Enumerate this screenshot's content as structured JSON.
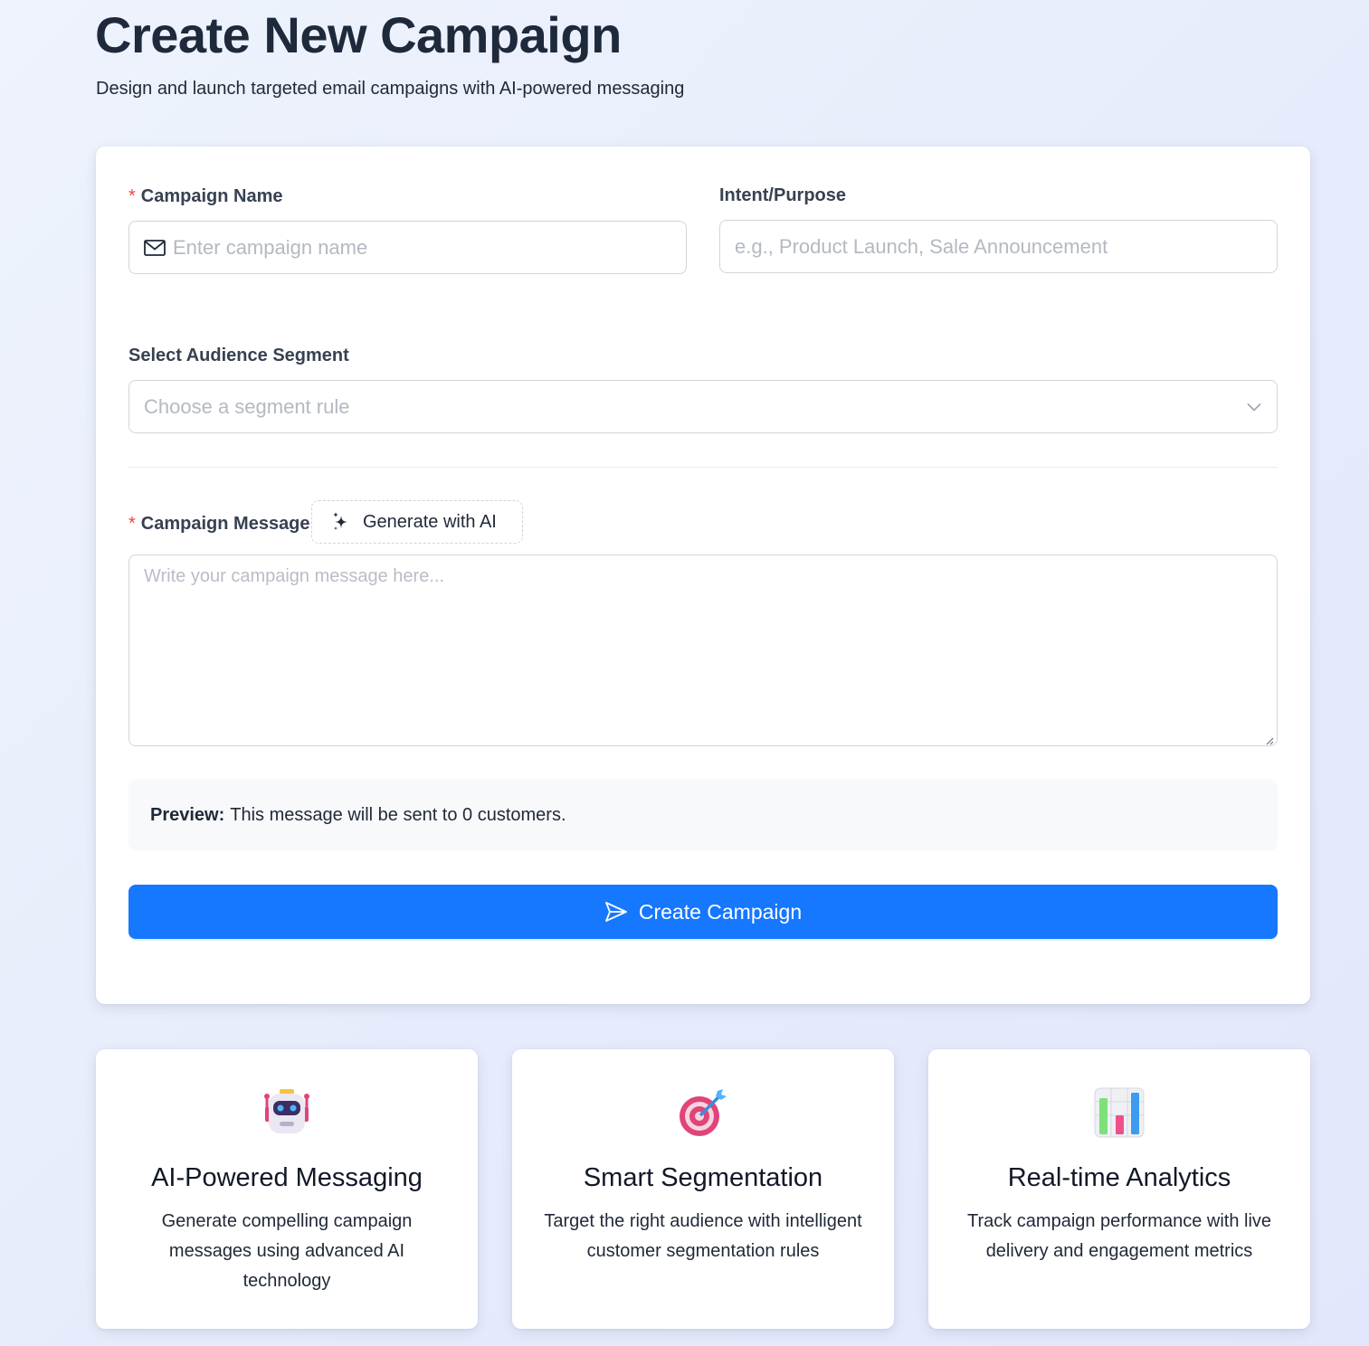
{
  "header": {
    "title": "Create New Campaign",
    "subtitle": "Design and launch targeted email campaigns with AI-powered messaging"
  },
  "form": {
    "campaign_name": {
      "label": "Campaign Name",
      "required_mark": "*",
      "placeholder": "Enter campaign name",
      "icon": "mail-icon"
    },
    "intent": {
      "label": "Intent/Purpose",
      "placeholder": "e.g., Product Launch, Sale Announcement"
    },
    "segment": {
      "label": "Select Audience Segment",
      "placeholder": "Choose a segment rule",
      "icon": "chevron-down-icon"
    },
    "message": {
      "label": "Campaign Message",
      "required_mark": "*",
      "placeholder": "Write your campaign message here...",
      "ai_button_label": "Generate with AI",
      "ai_icon": "sparkle-icon"
    },
    "preview": {
      "label": "Preview:",
      "text": "This message will be sent to 0 customers."
    },
    "submit": {
      "label": "Create Campaign",
      "icon": "send-icon"
    }
  },
  "features": [
    {
      "icon": "robot-icon",
      "title": "AI-Powered Messaging",
      "description": "Generate compelling campaign messages using advanced AI technology"
    },
    {
      "icon": "target-icon",
      "title": "Smart Segmentation",
      "description": "Target the right audience with intelligent customer segmentation rules"
    },
    {
      "icon": "bar-chart-icon",
      "title": "Real-time Analytics",
      "description": "Track campaign performance with live delivery and engagement metrics"
    }
  ],
  "colors": {
    "primary": "#1677ff",
    "required": "#ef4444",
    "title": "#1e293b"
  }
}
